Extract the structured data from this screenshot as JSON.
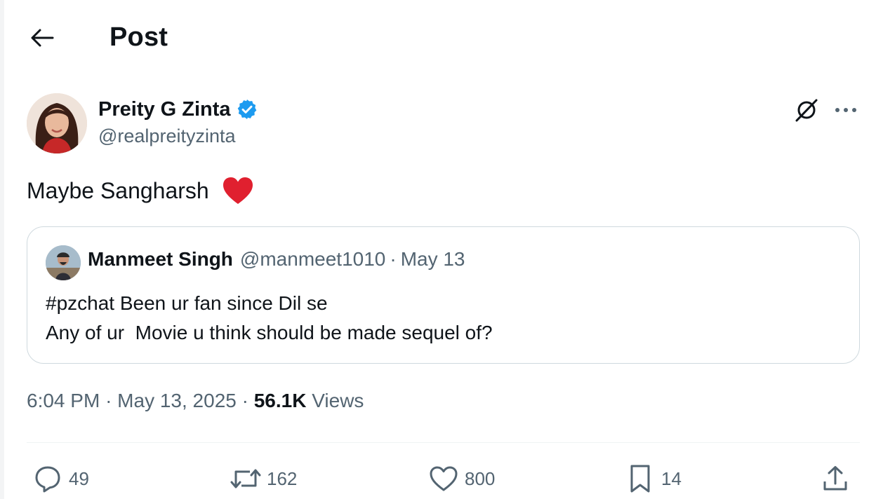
{
  "header": {
    "back_icon": "arrow-left-icon",
    "title": "Post"
  },
  "post": {
    "author": {
      "name": "Preity G Zinta",
      "handle": "@realpreityzinta",
      "verified": true,
      "verified_color": "#1d9bf0"
    },
    "text": "Maybe Sangharsh",
    "emoji_icon": "red-heart-icon",
    "top_icons": [
      "grok-icon",
      "more-icon"
    ],
    "quoted": {
      "name": "Manmeet Singh",
      "handle": "@manmeet1010",
      "separator": "·",
      "date": "May 13",
      "body": "#pzchat Been ur fan since Dil se\nAny of ur  Movie u think should be made sequel of?"
    },
    "meta": {
      "time": "6:04 PM",
      "separator": "·",
      "date": "May 13, 2025",
      "views_count": "56.1K",
      "views_label": "Views"
    },
    "actions": {
      "replies": "49",
      "reposts": "162",
      "likes": "800",
      "bookmarks": "14"
    }
  },
  "colors": {
    "text_primary": "#0f1419",
    "text_secondary": "#536471",
    "border": "#cfd9de",
    "heart": "#e0202f",
    "accent": "#1d9bf0"
  }
}
